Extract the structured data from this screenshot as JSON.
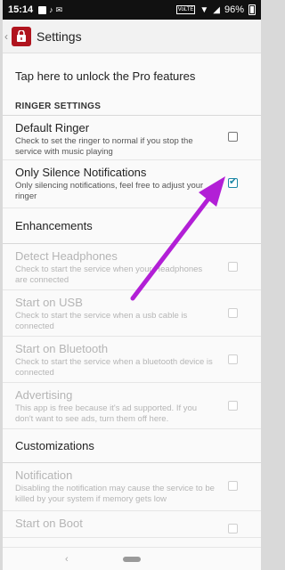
{
  "status_bar": {
    "time": "15:14",
    "battery": "96%",
    "volte": "VoLTE"
  },
  "app_bar": {
    "title": "Settings"
  },
  "pro_banner": "Tap here to unlock the Pro features",
  "sections": {
    "ringer_header": "RINGER SETTINGS",
    "enhancements": "Enhancements",
    "customizations": "Customizations"
  },
  "prefs": {
    "default_ringer": {
      "title": "Default Ringer",
      "summary": "Check to set the ringer to normal if you stop the service with music playing",
      "checked": false
    },
    "only_silence": {
      "title": "Only Silence Notifications",
      "summary": "Only silencing notifications, feel free to adjust your ringer",
      "checked": true
    },
    "detect_headphones": {
      "title": "Detect Headphones",
      "summary": "Check to start the service when your Headphones are connected"
    },
    "start_usb": {
      "title": "Start on USB",
      "summary": "Check to start the service when a usb cable is connected"
    },
    "start_bluetooth": {
      "title": "Start on Bluetooth",
      "summary": "Check to start the service when a bluetooth device is connected"
    },
    "advertising": {
      "title": "Advertising",
      "summary": "This app is free because it's ad supported. If you don't want to see ads, turn them off here."
    },
    "notification": {
      "title": "Notification",
      "summary": "Disabling the notification may cause the service to be killed by your system if memory gets low"
    },
    "start_boot": {
      "title": "Start on Boot",
      "summary": ""
    }
  },
  "colors": {
    "accent": "#1d87a6",
    "annotation_arrow": "#b21fd6",
    "app_icon": "#b0141e"
  }
}
